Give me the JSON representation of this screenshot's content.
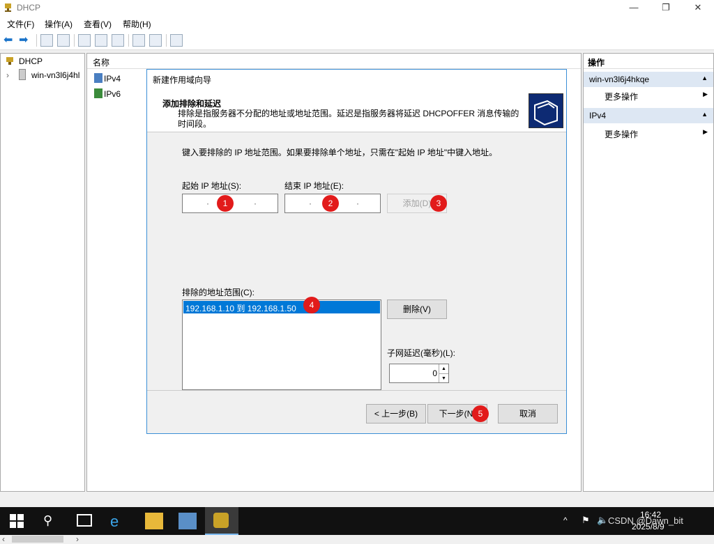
{
  "window": {
    "title": "DHCP"
  },
  "menu": [
    "文件(F)",
    "操作(A)",
    "查看(V)",
    "帮助(H)"
  ],
  "tree": {
    "root": "DHCP",
    "server": "win-vn3l6j4hl"
  },
  "middle": {
    "header": "名称",
    "items": [
      "IPv4",
      "IPv6"
    ]
  },
  "actions": {
    "header": "操作",
    "sections": [
      {
        "title": "win-vn3l6j4hkqe",
        "more": "更多操作"
      },
      {
        "title": "IPv4",
        "more": "更多操作"
      }
    ]
  },
  "wizard": {
    "title": "新建作用域向导",
    "heading": "添加排除和延迟",
    "description": "排除是指服务器不分配的地址或地址范围。延迟是指服务器将延迟 DHCPOFFER 消息传输的时间段。",
    "instruction": "键入要排除的 IP 地址范围。如果要排除单个地址，只需在\"起始 IP 地址\"中键入地址。",
    "start_ip_label": "起始 IP 地址(S):",
    "end_ip_label": "结束 IP 地址(E):",
    "add_label": "添加(D)",
    "excluded_label": "排除的地址范围(C):",
    "excluded_items": [
      "192.168.1.10 到 192.168.1.50"
    ],
    "delete_label": "删除(V)",
    "delay_label": "子网延迟(毫秒)(L):",
    "delay_value": "0",
    "back_label": "< 上一步(B)",
    "next_label": "下一步(N)",
    "cancel_label": "取消"
  },
  "badges": [
    "1",
    "2",
    "3",
    "4",
    "5"
  ],
  "taskbar": {
    "time": "16:42",
    "date": "2025/8/9",
    "watermark": "CSDN @Dawn_bit"
  },
  "colors": {
    "accent": "#0078d7",
    "badge": "#e21b1b",
    "taskbar": "#111111"
  }
}
